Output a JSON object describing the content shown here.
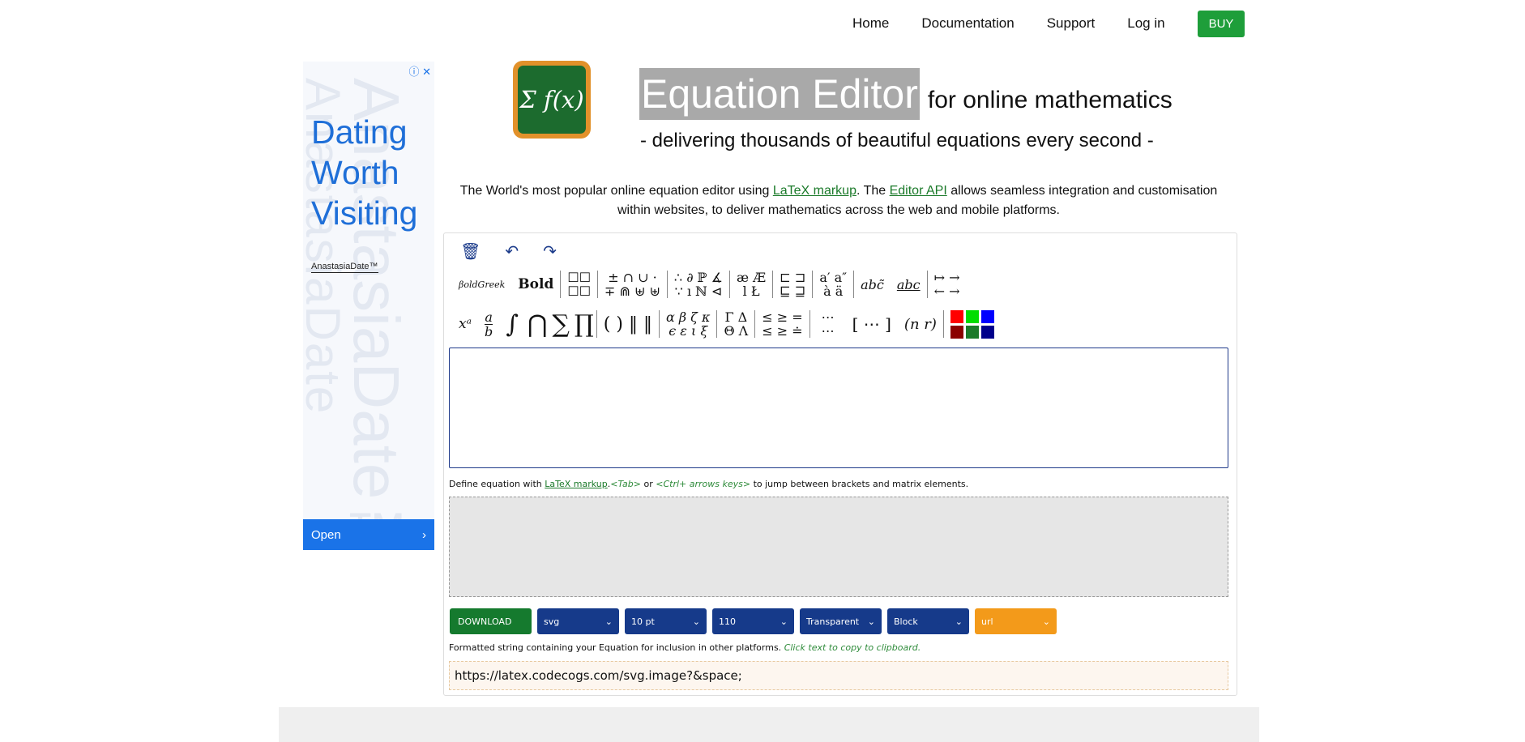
{
  "nav": {
    "home": "Home",
    "documentation": "Documentation",
    "support": "Support",
    "login": "Log in",
    "buy": "BUY"
  },
  "ad": {
    "icons": "ⓘ ✕",
    "headline": "Dating Worth Visiting",
    "brand": "AnastasiaDate™",
    "open": "Open",
    "open_icon": "›",
    "watermark": "AnastasiaDate",
    "watermark2": "AnastasiaDate™"
  },
  "logo": {
    "text": "Σ f(x)"
  },
  "header": {
    "title": "Equation Editor",
    "subtitle": "for online mathematics",
    "tagline": "- delivering thousands of beautiful equations every second -"
  },
  "intro": {
    "part1": "The World's most popular online equation editor using ",
    "link1": "LaTeX markup",
    "part2": ". The ",
    "link2": "Editor API",
    "part3": " allows seamless integration and customisation within websites, to deliver mathematics across the web and mobile platforms."
  },
  "tools": {
    "delete": "🗑",
    "undo": "↶",
    "redo": "↷"
  },
  "toolbar1": {
    "boldgreek": "βoldGreek",
    "bold": "Bold",
    "boxes_top": "☐☐",
    "boxes_bottom": "☐☐",
    "ops_top": "± ∩ ∪ ·",
    "ops_bottom": "∓ ⋒ ⊎ ⊎",
    "logic_top": "∴ ∂ ℙ ∡",
    "logic_bottom": "∵ ı ℕ ⊲",
    "ae_top": "æ Æ",
    "ae_bottom": "l Ł",
    "sets_top": "⊏ ⊐",
    "sets_bottom": "⊑ ⊒",
    "accents_top": "a′ a″",
    "accents_bottom": "à ä",
    "tilde": "abc̃",
    "underline": "abc",
    "arrows_top": "↦ →",
    "arrows_bottom": "← →"
  },
  "toolbar2": {
    "power": "xᵃ",
    "frac_top": "a",
    "frac_bottom": "b",
    "integral": "∫",
    "bigcap": "⋂",
    "sum": "∑",
    "prod": "∏",
    "brackets": "( ) ‖ ‖",
    "greek_top": "α β ζ κ",
    "greek_bottom": "ϵ ε ι ξ",
    "capgreek_top": "Γ Δ",
    "capgreek_bottom": "Θ Λ",
    "rel_top": "≤ ≥ =",
    "rel_bottom": "≤ ≥ ≐",
    "dots_top": "⋯",
    "dots_bottom": "⋯",
    "matrix": "[ ⋯ ]",
    "binom": "(n r)"
  },
  "swatch_colors": [
    "#ff0000",
    "#00dd00",
    "#0000ff",
    "#8b0000",
    "#1b7a2a",
    "#00008b"
  ],
  "editor": {
    "value": "",
    "placeholder": ""
  },
  "hint": {
    "part1": "Define equation with ",
    "link": "LaTeX markup",
    "part2": ".",
    "tab": "<Tab>",
    "or": " or ",
    "keys": "<Ctrl+ arrows keys>",
    "part3": " to jump between brackets and matrix elements."
  },
  "controls": {
    "download": "DOWNLOAD",
    "format": "svg",
    "size": "10 pt",
    "dpi": "110",
    "background": "Transparent",
    "display": "Block",
    "output": "url",
    "chevron": "⌄"
  },
  "fmt": {
    "text": "Formatted string containing your Equation for inclusion in other platforms. ",
    "hint": "Click text to copy to clipboard."
  },
  "output": {
    "value": "https://latex.codecogs.com/svg.image?&space;"
  }
}
